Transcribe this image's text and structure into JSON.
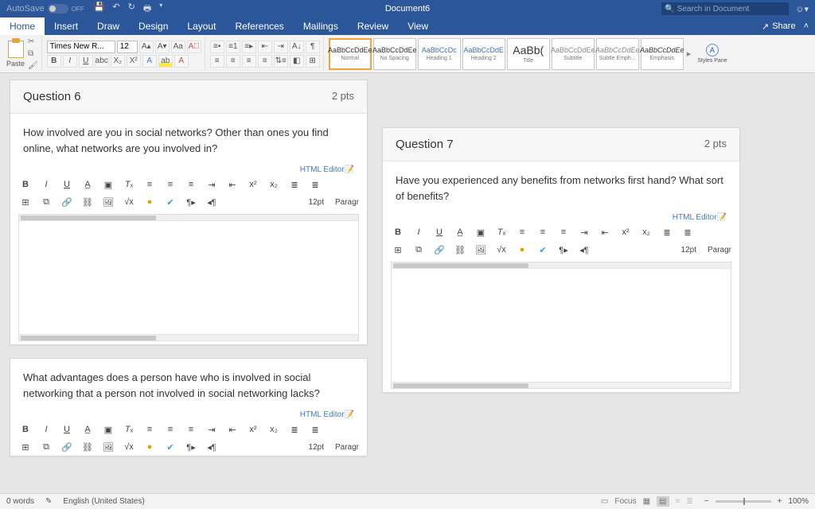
{
  "title_bar": {
    "autosave_label": "AutoSave",
    "autosave_state": "OFF",
    "doc_title": "Document6",
    "search_placeholder": "Search in Document"
  },
  "tabs": [
    "Home",
    "Insert",
    "Draw",
    "Design",
    "Layout",
    "References",
    "Mailings",
    "Review",
    "View"
  ],
  "active_tab": "Home",
  "share_label": "Share",
  "ribbon": {
    "paste_label": "Paste",
    "font_name": "Times New R...",
    "font_size": "12",
    "styles": [
      {
        "preview": "AaBbCcDdEe",
        "name": "Normal",
        "selected": true,
        "blue": false
      },
      {
        "preview": "AaBbCcDdEe",
        "name": "No Spacing",
        "selected": false,
        "blue": false
      },
      {
        "preview": "AaBbCcDc",
        "name": "Heading 1",
        "selected": false,
        "blue": true
      },
      {
        "preview": "AaBbCcDdE",
        "name": "Heading 2",
        "selected": false,
        "blue": true
      },
      {
        "preview": "AaBb(",
        "name": "Title",
        "selected": false,
        "blue": false
      },
      {
        "preview": "AaBbCcDdEe",
        "name": "Subtitle",
        "selected": false,
        "blue": false
      },
      {
        "preview": "AaBbCcDdEe",
        "name": "Subtle Emph...",
        "selected": false,
        "blue": false
      },
      {
        "preview": "AaBbCcDdEe",
        "name": "Emphasis",
        "selected": false,
        "blue": false
      }
    ],
    "styles_pane": "Styles Pane"
  },
  "questions": {
    "q6": {
      "title": "Question 6",
      "pts": "2 pts",
      "text": "How involved are you in social networks? Other than ones you find online, what networks are you involved in?"
    },
    "q6b": {
      "text": "What advantages does a person have who is involved in social networking that a person not involved in social networking lacks?"
    },
    "q7": {
      "title": "Question 7",
      "pts": "2 pts",
      "text": "Have you experienced any benefits from networks first hand? What sort of benefits?"
    }
  },
  "editor": {
    "link": "HTML Editor",
    "fontsize": "12pt",
    "para": "Paragr"
  },
  "status": {
    "words": "0 words",
    "lang": "English (United States)",
    "focus": "Focus",
    "zoom": "100%"
  }
}
